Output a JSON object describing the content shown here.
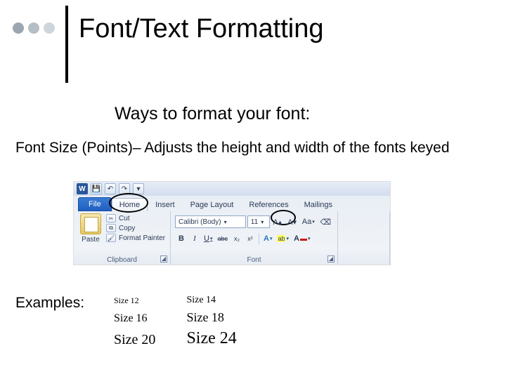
{
  "bullets_colors": [
    "#9aa7b0",
    "#b5bec5",
    "#cfd6db"
  ],
  "title": "Font/Text Formatting",
  "subtitle": "Ways to format your font:",
  "description": "Font Size (Points)– Adjusts the height and width of the fonts keyed",
  "ribbon": {
    "word_icon": "W",
    "qat": {
      "save": "💾",
      "undo": "↶",
      "redo": "↷",
      "more": "▾"
    },
    "tabs": {
      "file": "File",
      "home": "Home",
      "insert": "Insert",
      "page_layout": "Page Layout",
      "references": "References",
      "mailings": "Mailings"
    },
    "clipboard": {
      "paste": "Paste",
      "cut": "Cut",
      "copy": "Copy",
      "format_painter": "Format Painter",
      "label": "Clipboard"
    },
    "font": {
      "family": "Calibri (Body)",
      "size": "11",
      "grow": "A▴",
      "shrink": "A▾",
      "change_case": "Aa",
      "clear": "⌫",
      "bold": "B",
      "italic": "I",
      "underline": "U",
      "strike": "abc",
      "subscript": "x₂",
      "superscript": "x²",
      "effects": "A",
      "highlight": "ab",
      "highlight_color": "#ffff66",
      "fontcolor": "A",
      "fontcolor_swatch": "#d11507",
      "label": "Font"
    }
  },
  "examples_label": "Examples:",
  "examples": {
    "s12": "Size 12",
    "s14": "Size 14",
    "s16": "Size 16",
    "s18": "Size 18",
    "s20": "Size 20",
    "s24": "Size 24"
  }
}
